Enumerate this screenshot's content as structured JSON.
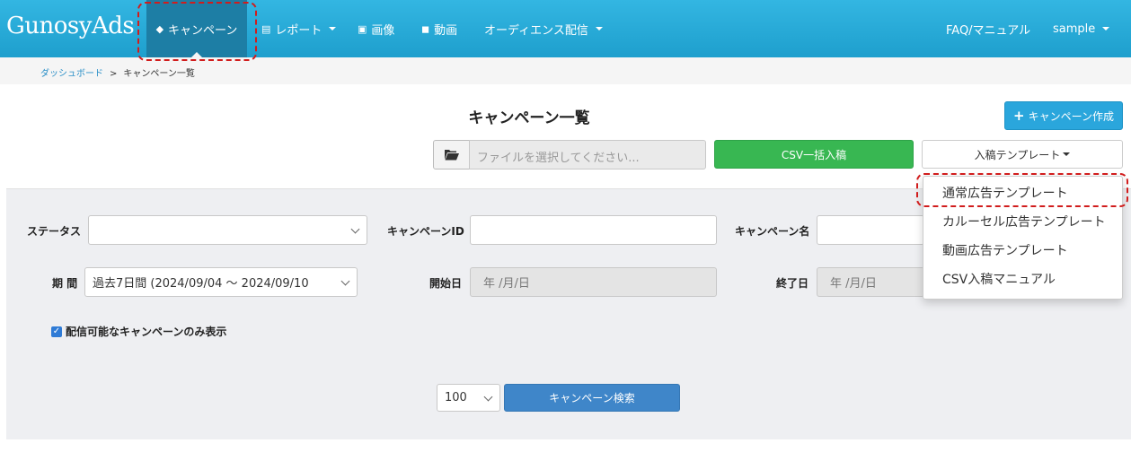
{
  "navbar": {
    "brand": "GunosyAds",
    "items": [
      {
        "label": "キャンペーン",
        "icon": "tag-icon"
      },
      {
        "label": "レポート",
        "icon": "list-icon"
      },
      {
        "label": "画像",
        "icon": "image-icon"
      },
      {
        "label": "動画",
        "icon": "video-camera-icon"
      },
      {
        "label": "オーディエンス配信"
      }
    ],
    "faq": "FAQ/マニュアル",
    "user": "sample"
  },
  "breadcrumb": {
    "home": "ダッシュボード",
    "separator": ">",
    "current": "キャンペーン一覧"
  },
  "page": {
    "title": "キャンペーン一覧"
  },
  "toolbar": {
    "create_label": "キャンペーン作成",
    "file_placeholder": "ファイルを選択してください...",
    "csv_label": "CSV一括入稿",
    "template_label": "入稿テンプレート"
  },
  "template_menu": {
    "items": [
      "通常広告テンプレート",
      "カルーセル広告テンプレート",
      "動画広告テンプレート",
      "CSV入稿マニュアル"
    ]
  },
  "filters": {
    "status_label": "ステータス",
    "status_value": "",
    "campaign_id_label": "キャンペーンID",
    "campaign_name_label": "キャンペーン名",
    "period_label": "期 間",
    "period_value": "過去7日間 (2024/09/04 〜 2024/09/10",
    "start_label": "開始日",
    "start_placeholder": "年 /月/日",
    "end_label": "終了日",
    "end_placeholder": "年 /月/日",
    "deliverable_only_label": "配信可能なキャンペーンのみ表示",
    "deliverable_only_checked": true,
    "per_page": "100",
    "search_label": "キャンペーン検索"
  },
  "colors": {
    "navbar": "#29abd9",
    "active": "#1d7ea5",
    "success": "#38b752",
    "primary": "#3f86c9",
    "highlight": "#d11c1c"
  }
}
